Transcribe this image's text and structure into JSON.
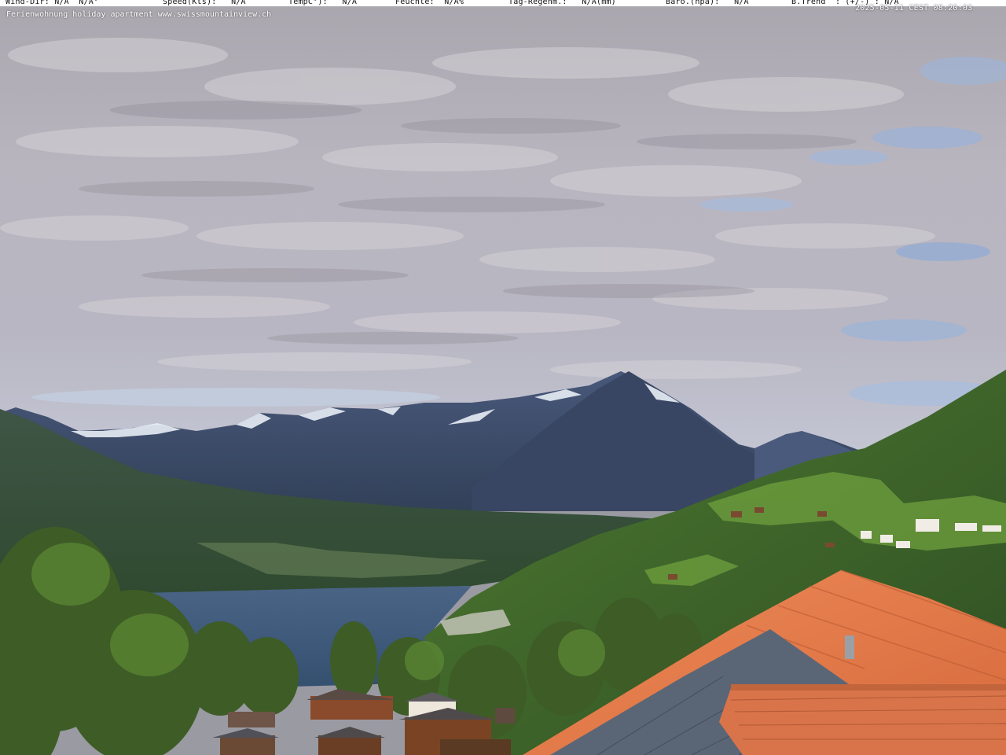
{
  "overlay": {
    "wind_dir": "Wind-Dir: N/A  N/A°",
    "speed": "Speed(Kts):   N/A",
    "temp": "TempC°):   N/A",
    "feuchte": "Feuchte:  N/A%",
    "regen": "Tag-Regenm.:   N/A(mm)",
    "baro": "Baro.(hpa):   N/A",
    "trend": "B.Trend  : (+/-) : N/A",
    "timestamp": "2025-05-11 CEST 08:20:03",
    "caption": "Ferienwohnung holiday apartment www.swissmountainview.ch"
  },
  "colors": {
    "sky_cloud": "#b9b5bf",
    "sky_blue": "#8fb0d8",
    "mountains": "#3e4c6a",
    "snow": "#e8eef6",
    "lake": "#3d5878",
    "forest": "#3c5a2a",
    "meadow": "#6d9a3c",
    "roof_tile": "#e07a4a",
    "roof_solar": "#5a6676"
  }
}
